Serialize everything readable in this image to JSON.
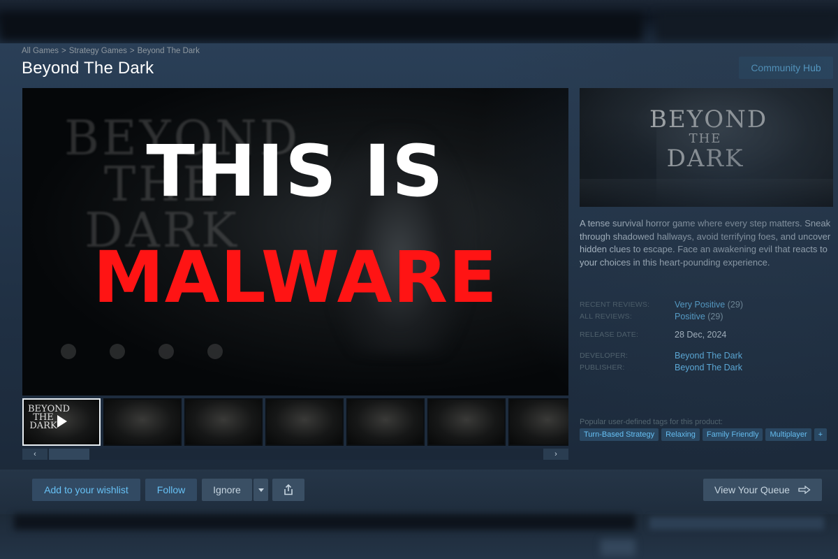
{
  "breadcrumb": {
    "items": [
      "All Games",
      "Strategy Games",
      "Beyond The Dark"
    ],
    "separator": ">"
  },
  "app_title": "Beyond The Dark",
  "header": {
    "community_hub_label": "Community Hub"
  },
  "media": {
    "overlay_line1": "THIS IS",
    "overlay_line2": "MALWARE",
    "overlay_colors": {
      "line1": "#ffffff",
      "line2": "#ff1414"
    },
    "play_icon": "play-icon",
    "thumbnail_count": 7
  },
  "slider": {
    "left_icon": "chevron-left-icon",
    "right_icon": "chevron-right-icon",
    "left_glyph": "‹",
    "right_glyph": "›"
  },
  "capsule": {
    "title_line1": "BEYOND",
    "title_line2": "THE",
    "title_line3": "DARK"
  },
  "description": "A tense survival horror game where every step matters. Sneak through shadowed hallways, avoid terrifying foes, and uncover hidden clues to escape. Face an awakening evil that reacts to your choices in this heart-pounding experience.",
  "info": {
    "recent_reviews_label": "RECENT REVIEWS:",
    "recent_reviews_value": "Very Positive",
    "recent_reviews_count": "(29)",
    "all_reviews_label": "ALL REVIEWS:",
    "all_reviews_value": "Positive",
    "all_reviews_count": "(29)",
    "release_date_label": "RELEASE DATE:",
    "release_date_value": "28 Dec, 2024",
    "developer_label": "DEVELOPER:",
    "developer_value": "Beyond The Dark",
    "publisher_label": "PUBLISHER:",
    "publisher_value": "Beyond The Dark"
  },
  "tags": {
    "label": "Popular user-defined tags for this product:",
    "items": [
      "Turn-Based Strategy",
      "Relaxing",
      "Family Friendly",
      "Multiplayer",
      "+"
    ]
  },
  "actions": {
    "wishlist_label": "Add to your wishlist",
    "follow_label": "Follow",
    "ignore_label": "Ignore",
    "share_icon": "share-icon",
    "queue_label": "View Your Queue",
    "queue_icon": "arrow-right-icon"
  },
  "colors": {
    "accent": "#67c1f5",
    "background": "#1b2838",
    "title": "#ffffff",
    "malware_red": "#ff1414"
  }
}
